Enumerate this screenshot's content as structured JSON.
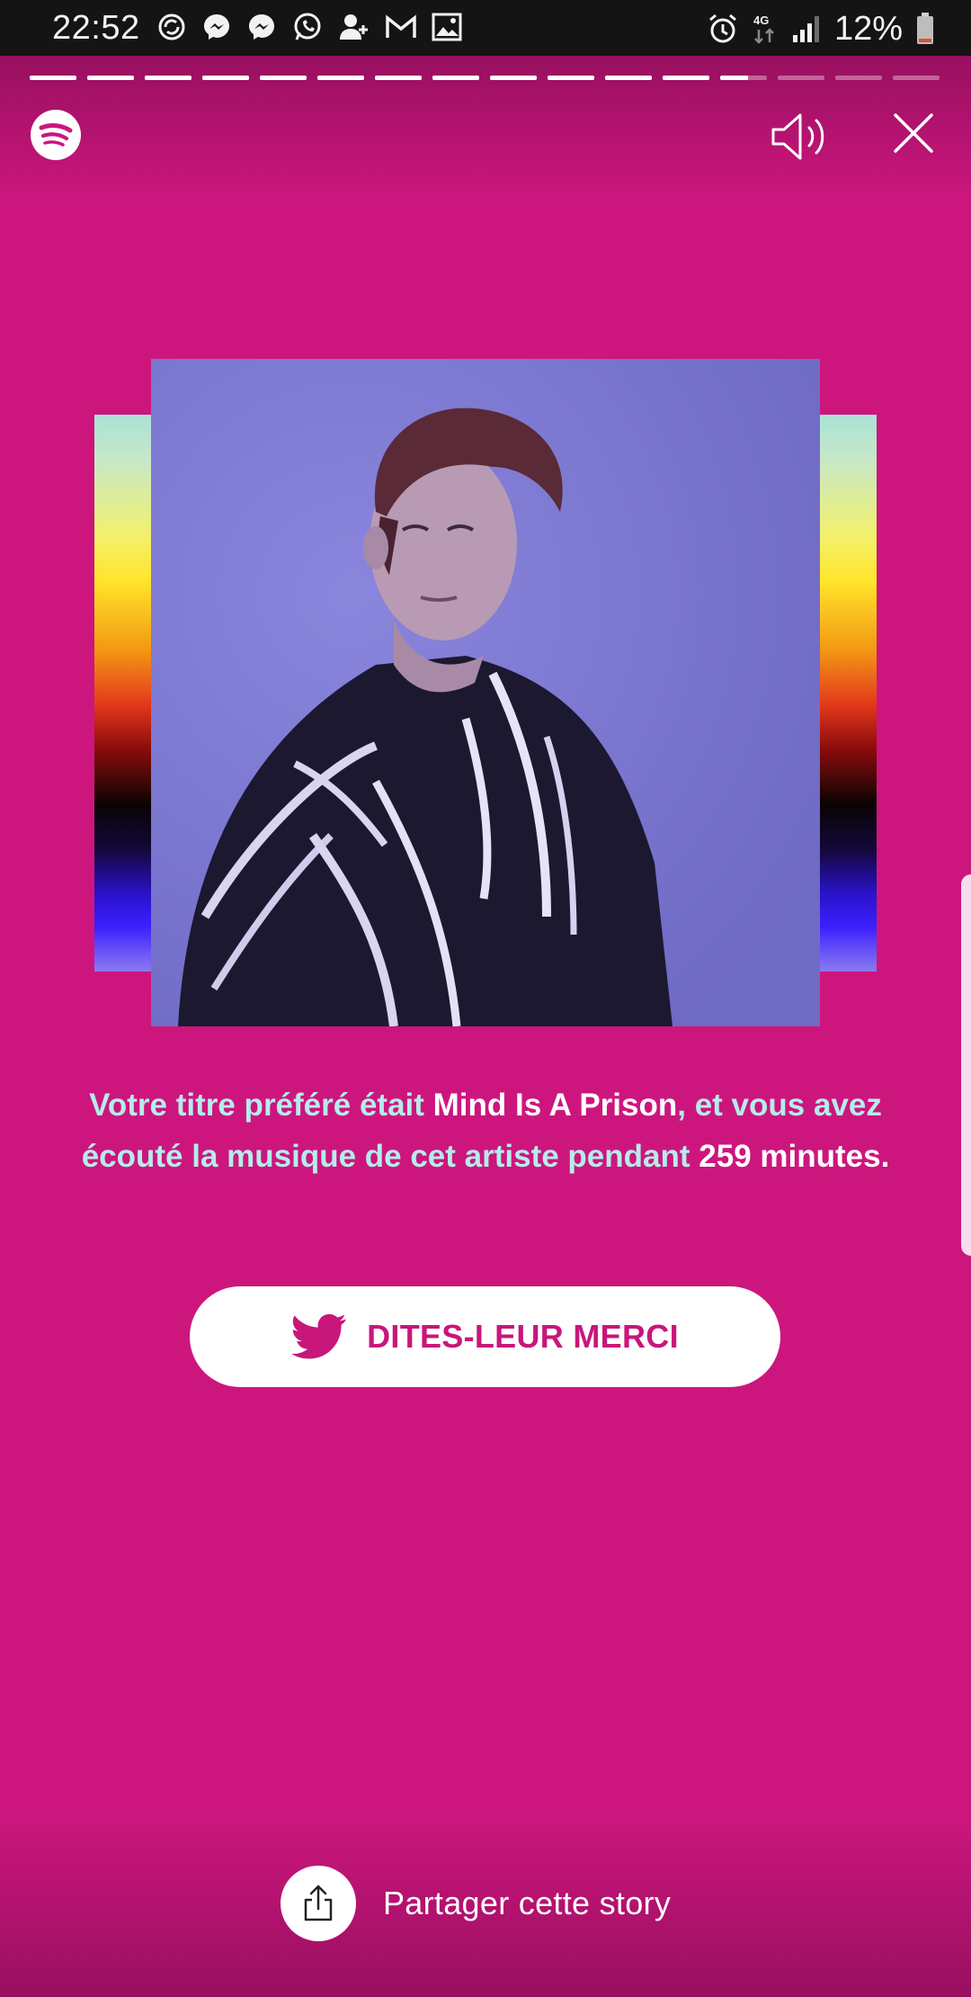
{
  "status_bar": {
    "time": "22:52",
    "battery_percent": "12%",
    "network_type": "4G",
    "notification_icons": [
      "sync-icon",
      "messenger-icon",
      "messenger-icon",
      "whatsapp-icon",
      "add-contact-icon",
      "gmail-icon",
      "gallery-icon"
    ],
    "right_icons": [
      "alarm-icon",
      "data-4g-icon",
      "signal-icon",
      "battery-icon"
    ],
    "battery_color": "#e0522a"
  },
  "story": {
    "total_segments": 16,
    "completed_segments": 12,
    "current_segment_progress": 0.6
  },
  "controls": {
    "logo": "spotify-logo",
    "volume_icon": "volume-icon",
    "close_icon": "close-icon"
  },
  "message": {
    "intro": "Votre titre préféré était ",
    "track": "Mind Is A Prison",
    "middle": ", et vous avez écouté la musique de cet artiste pendant ",
    "minutes": "259 minutes."
  },
  "thank_button": {
    "label": "DITES-LEUR MERCI",
    "icon": "twitter-icon"
  },
  "share": {
    "label": "Partager cette story",
    "icon": "share-icon"
  },
  "colors": {
    "background": "#cc167e",
    "message_text": "#b5ecea",
    "button_text": "#c8167b"
  }
}
